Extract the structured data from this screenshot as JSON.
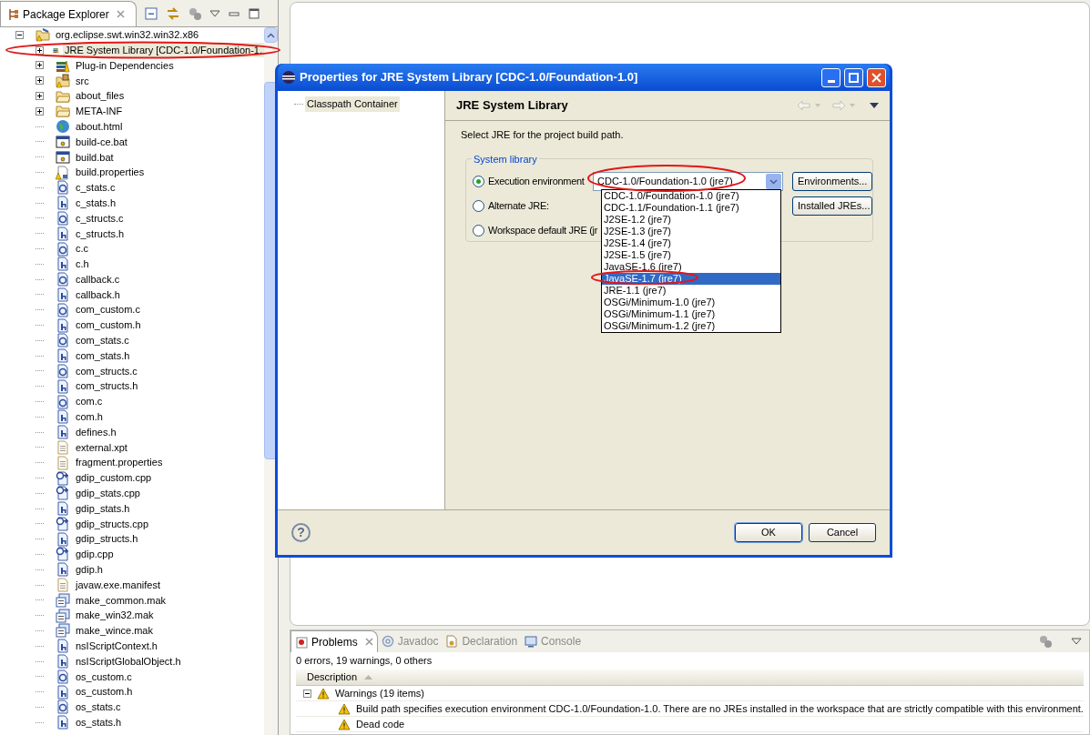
{
  "package_explorer": {
    "tab": {
      "label": "Package Explorer",
      "selected": true
    },
    "tree": [
      {
        "label": "org.eclipse.swt.win32.win32.x86",
        "kind": "project",
        "expanded": true,
        "selected": false,
        "children": [
          {
            "label": "JRE System Library [CDC-1.0/Foundation-1.",
            "kind": "library",
            "expanded": false,
            "selected": true
          },
          {
            "label": "Plug-in Dependencies",
            "kind": "library",
            "expanded": false,
            "selected": false
          },
          {
            "label": "src",
            "kind": "source-folder",
            "expanded": false,
            "selected": false
          },
          {
            "label": "about_files",
            "kind": "folder",
            "expanded": false,
            "selected": false
          },
          {
            "label": "META-INF",
            "kind": "folder",
            "expanded": false,
            "selected": false
          },
          {
            "label": "about.html",
            "kind": "html",
            "selected": false
          },
          {
            "label": "build-ce.bat",
            "kind": "bat",
            "selected": false
          },
          {
            "label": "build.bat",
            "kind": "bat",
            "selected": false
          },
          {
            "label": "build.properties",
            "kind": "properties",
            "selected": false
          },
          {
            "label": "c_stats.c",
            "kind": "c",
            "selected": false
          },
          {
            "label": "c_stats.h",
            "kind": "h",
            "selected": false
          },
          {
            "label": "c_structs.c",
            "kind": "c",
            "selected": false
          },
          {
            "label": "c_structs.h",
            "kind": "h",
            "selected": false
          },
          {
            "label": "c.c",
            "kind": "c",
            "selected": false
          },
          {
            "label": "c.h",
            "kind": "h",
            "selected": false
          },
          {
            "label": "callback.c",
            "kind": "c",
            "selected": false
          },
          {
            "label": "callback.h",
            "kind": "h",
            "selected": false
          },
          {
            "label": "com_custom.c",
            "kind": "c",
            "selected": false
          },
          {
            "label": "com_custom.h",
            "kind": "h",
            "selected": false
          },
          {
            "label": "com_stats.c",
            "kind": "c",
            "selected": false
          },
          {
            "label": "com_stats.h",
            "kind": "h",
            "selected": false
          },
          {
            "label": "com_structs.c",
            "kind": "c",
            "selected": false
          },
          {
            "label": "com_structs.h",
            "kind": "h",
            "selected": false
          },
          {
            "label": "com.c",
            "kind": "c",
            "selected": false
          },
          {
            "label": "com.h",
            "kind": "h",
            "selected": false
          },
          {
            "label": "defines.h",
            "kind": "h",
            "selected": false
          },
          {
            "label": "external.xpt",
            "kind": "text",
            "selected": false
          },
          {
            "label": "fragment.properties",
            "kind": "text",
            "selected": false
          },
          {
            "label": "gdip_custom.cpp",
            "kind": "cpp",
            "selected": false
          },
          {
            "label": "gdip_stats.cpp",
            "kind": "cpp",
            "selected": false
          },
          {
            "label": "gdip_stats.h",
            "kind": "h",
            "selected": false
          },
          {
            "label": "gdip_structs.cpp",
            "kind": "cpp",
            "selected": false
          },
          {
            "label": "gdip_structs.h",
            "kind": "h",
            "selected": false
          },
          {
            "label": "gdip.cpp",
            "kind": "cpp",
            "selected": false
          },
          {
            "label": "gdip.h",
            "kind": "h",
            "selected": false
          },
          {
            "label": "javaw.exe.manifest",
            "kind": "text",
            "selected": false
          },
          {
            "label": "make_common.mak",
            "kind": "mak",
            "selected": false
          },
          {
            "label": "make_win32.mak",
            "kind": "mak",
            "selected": false
          },
          {
            "label": "make_wince.mak",
            "kind": "mak",
            "selected": false
          },
          {
            "label": "nsIScriptContext.h",
            "kind": "h",
            "selected": false
          },
          {
            "label": "nsIScriptGlobalObject.h",
            "kind": "h",
            "selected": false
          },
          {
            "label": "os_custom.c",
            "kind": "c",
            "selected": false
          },
          {
            "label": "os_custom.h",
            "kind": "h",
            "selected": false
          },
          {
            "label": "os_stats.c",
            "kind": "c",
            "selected": false
          },
          {
            "label": "os_stats.h",
            "kind": "h",
            "selected": false
          }
        ]
      }
    ]
  },
  "dialog": {
    "title": "Properties for JRE System Library [CDC-1.0/Foundation-1.0]",
    "nav": [
      {
        "label": "Classpath Container",
        "selected": true
      }
    ],
    "page_title": "JRE System Library",
    "description": "Select JRE for the project build path.",
    "group_label": "System library",
    "options": [
      {
        "label": "Execution environment",
        "selected": true
      },
      {
        "label": "Alternate JRE:",
        "selected": false
      },
      {
        "label": "Workspace default JRE (jr",
        "selected": false
      }
    ],
    "combo": {
      "value": "CDC-1.0/Foundation-1.0 (jre7)",
      "expanded": true
    },
    "side_buttons": [
      "Environments...",
      "Installed JREs..."
    ],
    "dropdown": [
      {
        "label": "CDC-1.0/Foundation-1.0 (jre7)",
        "selected": false
      },
      {
        "label": "CDC-1.1/Foundation-1.1 (jre7)",
        "selected": false
      },
      {
        "label": "J2SE-1.2 (jre7)",
        "selected": false
      },
      {
        "label": "J2SE-1.3 (jre7)",
        "selected": false
      },
      {
        "label": "J2SE-1.4 (jre7)",
        "selected": false
      },
      {
        "label": "J2SE-1.5 (jre7)",
        "selected": false
      },
      {
        "label": "JavaSE-1.6 (jre7)",
        "selected": false
      },
      {
        "label": "JavaSE-1.7 (jre7)",
        "selected": true
      },
      {
        "label": "JRE-1.1 (jre7)",
        "selected": false
      },
      {
        "label": "OSGi/Minimum-1.0 (jre7)",
        "selected": false
      },
      {
        "label": "OSGi/Minimum-1.1 (jre7)",
        "selected": false
      },
      {
        "label": "OSGi/Minimum-1.2 (jre7)",
        "selected": false
      }
    ],
    "help": "?",
    "footer_buttons": [
      "OK",
      "Cancel"
    ]
  },
  "problems": {
    "tabs": [
      {
        "label": "Problems",
        "kind": "problems",
        "selected": true
      },
      {
        "label": "Javadoc",
        "kind": "javadoc",
        "selected": false
      },
      {
        "label": "Declaration",
        "kind": "declaration",
        "selected": false
      },
      {
        "label": "Console",
        "kind": "console",
        "selected": false
      }
    ],
    "summary": "0 errors, 19 warnings, 0 others",
    "column": "Description",
    "groups": [
      {
        "label": "Warnings (19 items)",
        "expanded": true,
        "children": [
          {
            "text": "Build path specifies execution environment CDC-1.0/Foundation-1.0. There are no JREs installed in the workspace that are strictly compatible with this environment."
          },
          {
            "text": "Dead code"
          }
        ]
      }
    ]
  }
}
